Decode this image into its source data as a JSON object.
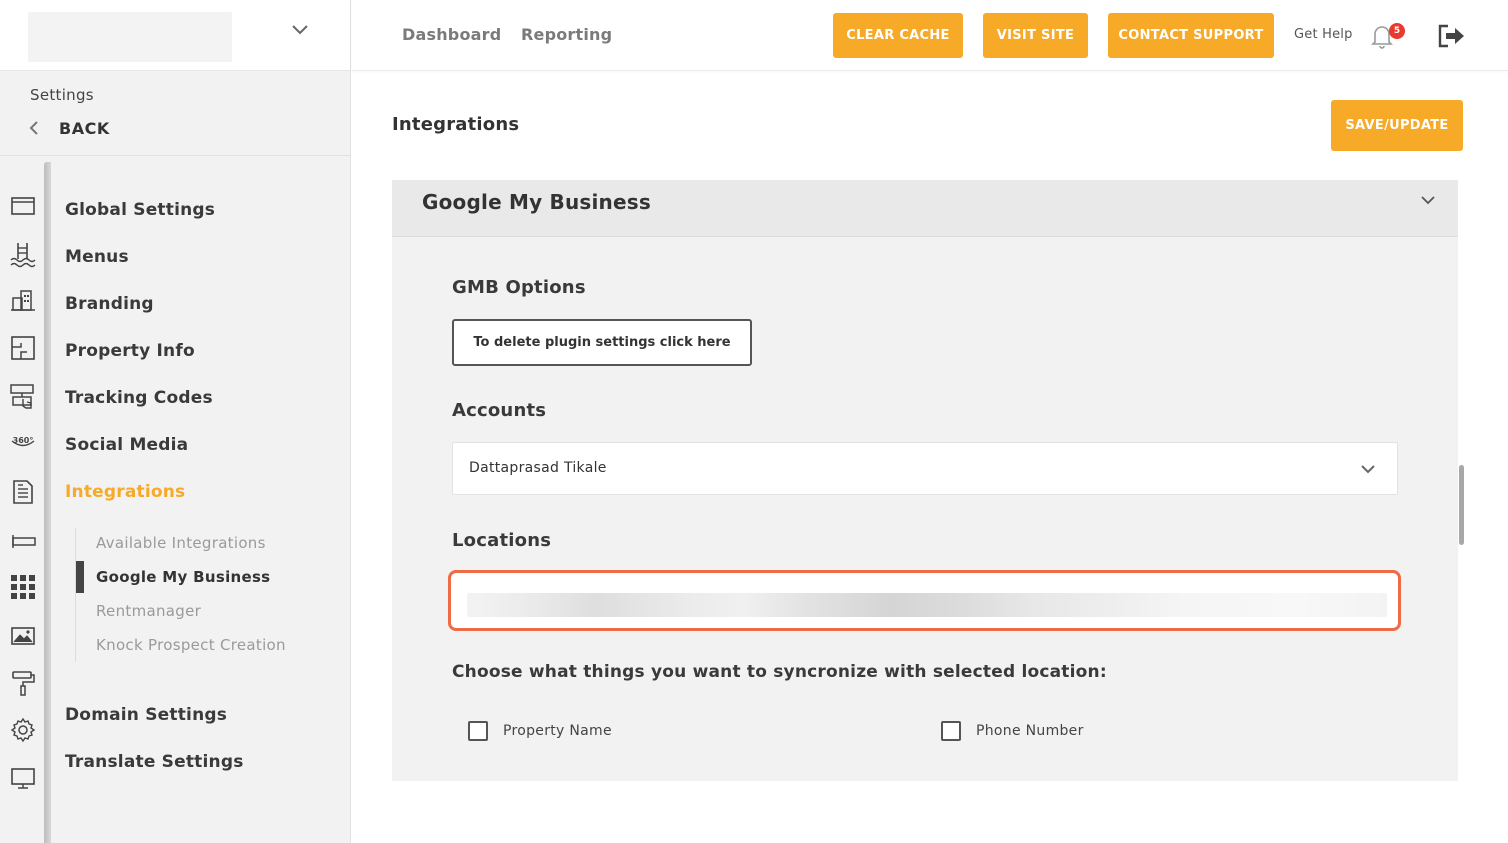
{
  "colors": {
    "accent": "#f7a928",
    "highlight_border": "#ee6b45",
    "badge": "#e83a2e"
  },
  "sidebar": {
    "settings_label": "Settings",
    "back_label": "BACK",
    "rail_icons": [
      "window-icon",
      "pool-icon",
      "buildings-icon",
      "floorplan-icon",
      "touch-screen-icon",
      "360-view-icon",
      "document-icon",
      "tag-icon",
      "grid-icon",
      "image-icon",
      "paint-roller-icon",
      "gear-icon",
      "monitor-icon"
    ],
    "items": [
      {
        "label": "Global Settings"
      },
      {
        "label": "Menus"
      },
      {
        "label": "Branding"
      },
      {
        "label": "Property Info"
      },
      {
        "label": "Tracking Codes"
      },
      {
        "label": "Social Media"
      },
      {
        "label": "Integrations",
        "active": true
      },
      {
        "label": "Domain Settings"
      },
      {
        "label": "Translate Settings"
      }
    ],
    "sub_items": [
      {
        "label": "Available Integrations"
      },
      {
        "label": "Google My Business",
        "active": true
      },
      {
        "label": "Rentmanager"
      },
      {
        "label": "Knock Prospect Creation"
      }
    ]
  },
  "topbar": {
    "links": [
      "Dashboard",
      "Reporting"
    ],
    "buttons": [
      "CLEAR CACHE",
      "VISIT SITE",
      "CONTACT SUPPORT"
    ],
    "get_help": "Get Help",
    "notification_count": "5"
  },
  "main": {
    "page_title": "Integrations",
    "save_button": "SAVE/UPDATE",
    "panel_title": "Google My Business",
    "gmb_options_label": "GMB Options",
    "delete_button": "To delete plugin settings click here",
    "accounts_label": "Accounts",
    "accounts_value": "Dattaprasad Tikale",
    "locations_label": "Locations",
    "sync_label": "Choose what things you want to syncronize with selected location:",
    "checkboxes": [
      {
        "label": "Property Name",
        "checked": false
      },
      {
        "label": "Phone Number",
        "checked": false
      }
    ]
  }
}
